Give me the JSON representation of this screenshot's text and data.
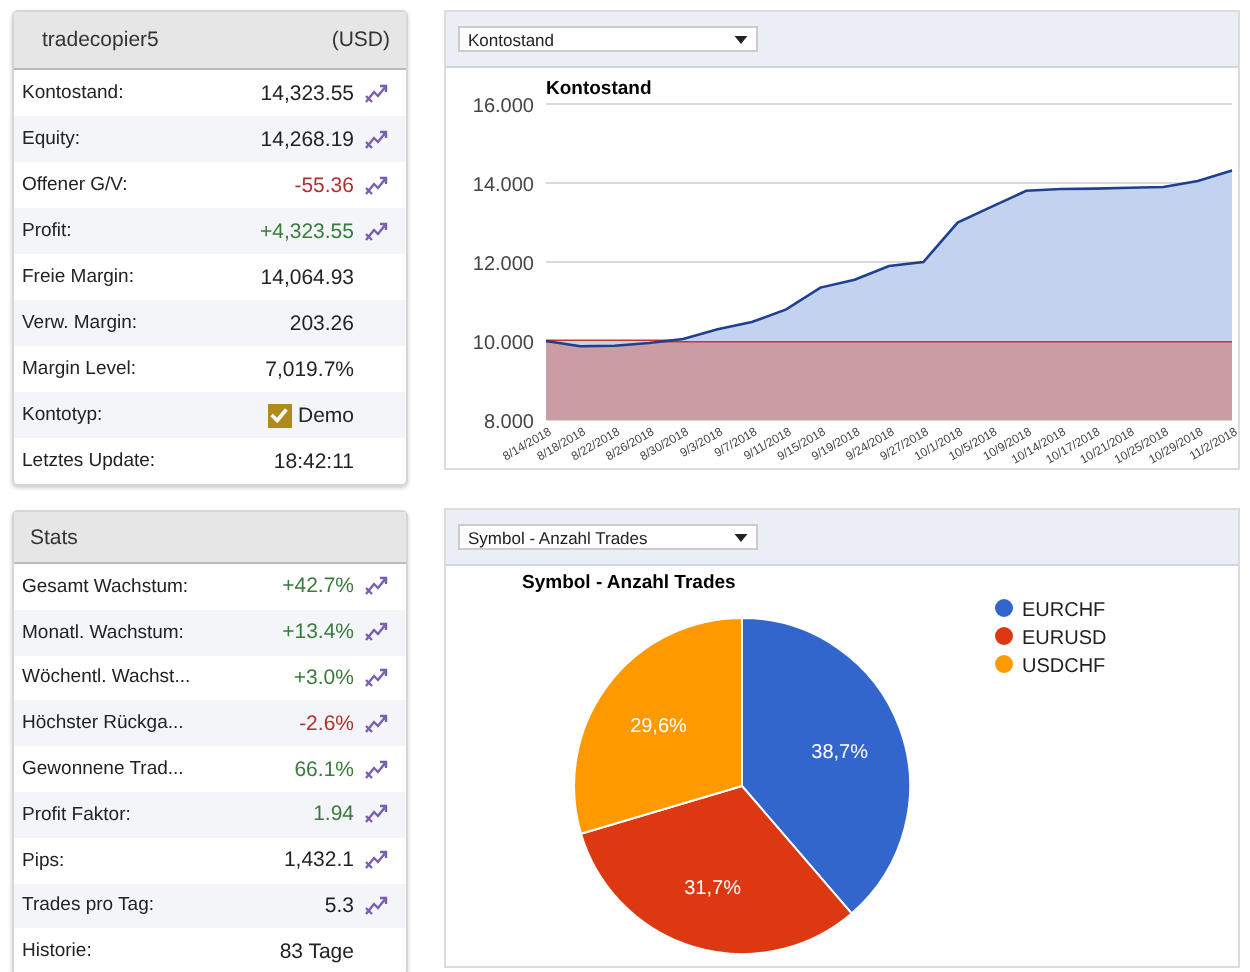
{
  "account": {
    "name": "tradecopier5",
    "currency": "(USD)",
    "rows": [
      {
        "label": "Kontostand:",
        "value": "14,323.55",
        "chart_icon": true
      },
      {
        "label": "Equity:",
        "value": "14,268.19",
        "chart_icon": true
      },
      {
        "label": "Offener G/V:",
        "value": "-55.36",
        "color": "#b03030",
        "chart_icon": true
      },
      {
        "label": "Profit:",
        "value": "+4,323.55",
        "color": "#3a7a3a",
        "chart_icon": true
      },
      {
        "label": "Freie Margin:",
        "value": "14,064.93",
        "chart_icon": false
      },
      {
        "label": "Verw. Margin:",
        "value": "203.26",
        "chart_icon": false
      },
      {
        "label": "Margin Level:",
        "value": "7,019.7%",
        "chart_icon": false
      },
      {
        "label": "Kontotyp:",
        "value": "Demo",
        "chart_icon": false,
        "kind": "checkbox",
        "checked": true
      },
      {
        "label": "Letztes Update:",
        "value": "18:42:11",
        "chart_icon": false
      }
    ]
  },
  "stats": {
    "title": "Stats",
    "rows": [
      {
        "label": "Gesamt Wachstum:",
        "value": "+42.7%",
        "color": "#3a7a3a",
        "chart_icon": true
      },
      {
        "label": "Monatl. Wachstum:",
        "value": "+13.4%",
        "color": "#3a7a3a",
        "chart_icon": true
      },
      {
        "label": "Wöchentl. Wachst...",
        "value": "+3.0%",
        "color": "#3a7a3a",
        "chart_icon": true
      },
      {
        "label": "Höchster Rückga...",
        "value": "-2.6%",
        "color": "#b03030",
        "chart_icon": true
      },
      {
        "label": "Gewonnene Trad...",
        "value": "66.1%",
        "color": "#3a7a3a",
        "chart_icon": true
      },
      {
        "label": "Profit Faktor:",
        "value": "1.94",
        "color": "#3a7a3a",
        "chart_icon": true
      },
      {
        "label": "Pips:",
        "value": "1,432.1",
        "chart_icon": true
      },
      {
        "label": "Trades pro Tag:",
        "value": "5.3",
        "chart_icon": true
      },
      {
        "label": "Historie:",
        "value": "83 Tage",
        "chart_icon": false
      }
    ]
  },
  "balance_panel": {
    "dropdown": "Kontostand",
    "chart_data": {
      "type": "area",
      "title": "Kontostand",
      "categories": [
        "8/14/2018",
        "8/18/2018",
        "8/22/2018",
        "8/26/2018",
        "8/30/2018",
        "9/3/2018",
        "9/7/2018",
        "9/11/2018",
        "9/15/2018",
        "9/19/2018",
        "9/24/2018",
        "9/27/2018",
        "10/1/2018",
        "10/5/2018",
        "10/9/2018",
        "10/14/2018",
        "10/17/2018",
        "10/21/2018",
        "10/25/2018",
        "10/29/2018",
        "11/2/2018"
      ],
      "series": [
        {
          "color": "#1f3f8f",
          "values": [
            10,
            9.87,
            9.88,
            9.95,
            10.05,
            10.3,
            10.48,
            10.8,
            11.35,
            11.55,
            11.9,
            12,
            13,
            13.4,
            13.8,
            13.85,
            13.86,
            13.88,
            13.9,
            14.05,
            14.32
          ]
        },
        {
          "color": "#cc3333",
          "values": [
            10,
            10,
            10,
            10,
            10,
            10,
            10,
            10,
            10,
            10,
            10,
            10,
            10,
            10,
            10,
            10,
            10,
            10,
            10,
            10,
            10
          ]
        }
      ],
      "ylim": [
        8,
        16
      ],
      "yticks": [
        {
          "value": 8,
          "label": "8.000"
        },
        {
          "value": 10,
          "label": "10.000"
        },
        {
          "value": 12,
          "label": "12.000"
        },
        {
          "value": 14,
          "label": "14.000"
        },
        {
          "value": 16,
          "label": "16.000"
        }
      ]
    }
  },
  "symbol_panel": {
    "dropdown": "Symbol - Anzahl Trades",
    "chart_data": {
      "type": "pie",
      "title": "Symbol - Anzahl Trades",
      "categories": [
        "EURCHF",
        "EURUSD",
        "USDCHF"
      ],
      "series": [
        {
          "values": [
            38.7,
            31.7,
            29.6
          ]
        }
      ],
      "colors": [
        "#3366cc",
        "#dc3912",
        "#ff9900"
      ],
      "value_labels": [
        "38,7%",
        "31,7%",
        "29,6%"
      ],
      "legend": "right"
    }
  }
}
